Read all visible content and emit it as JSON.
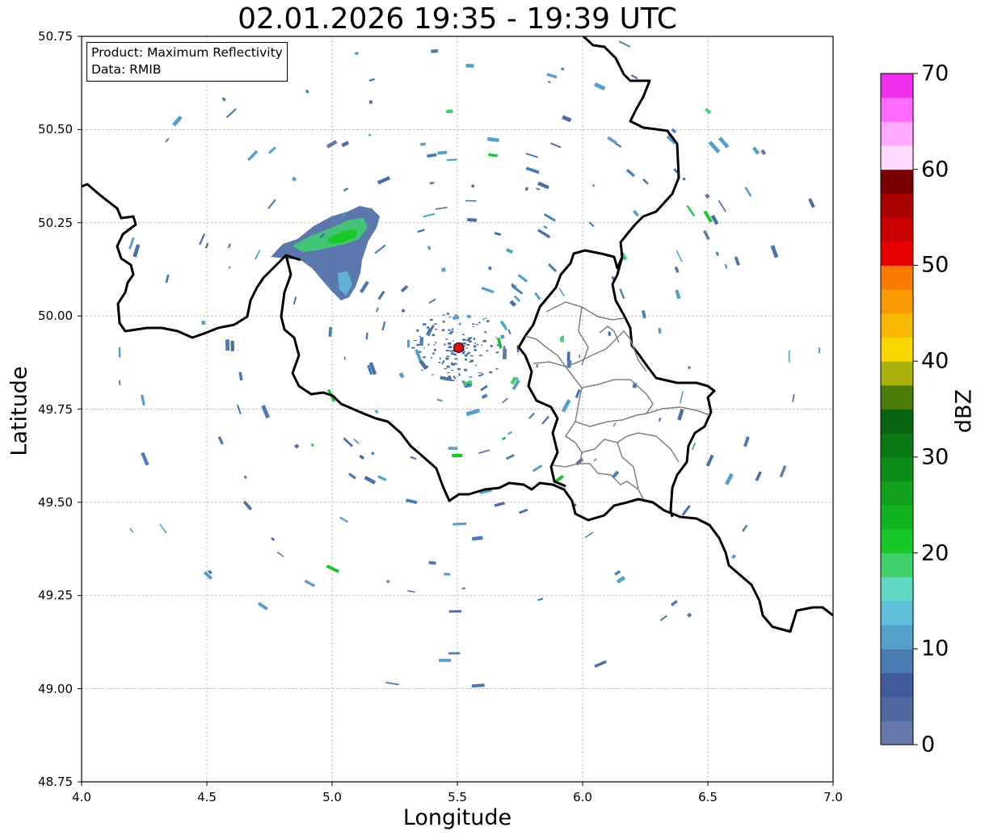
{
  "title": "02.01.2026 19:35 - 19:39 UTC",
  "info": {
    "product": "Product: Maximum Reflectivity",
    "data": "Data: RMIB"
  },
  "axes": {
    "xlabel": "Longitude",
    "ylabel": "Latitude",
    "xlim": [
      4.0,
      7.0
    ],
    "ylim": [
      48.75,
      50.75
    ],
    "xticks": [
      "4.0",
      "4.5",
      "5.0",
      "5.5",
      "6.0",
      "6.5",
      "7.0"
    ],
    "yticks": [
      "50.75",
      "50.50",
      "50.25",
      "50.00",
      "49.75",
      "49.50",
      "49.25",
      "49.00",
      "48.75"
    ],
    "grid": true
  },
  "colorbar": {
    "label": "dBZ",
    "min": 0,
    "max": 70,
    "step": 2.5,
    "ticks": [
      "0",
      "10",
      "20",
      "30",
      "40",
      "50",
      "60",
      "70"
    ],
    "colors": [
      "#6478aa",
      "#53679f",
      "#415a9c",
      "#4a7db4",
      "#55a0c8",
      "#60c0dc",
      "#60d8c4",
      "#40d06c",
      "#18c828",
      "#10b420",
      "#10a01c",
      "#0c8c18",
      "#0a7814",
      "#066410",
      "#4a7a08",
      "#aab00a",
      "#f8d800",
      "#f8b800",
      "#f89a00",
      "#f87a00",
      "#e80000",
      "#c80000",
      "#a80000",
      "#780000",
      "#ffdcff",
      "#ffaaff",
      "#ff6aff",
      "#ee30ee"
    ]
  },
  "radar_site": {
    "lon": 5.505,
    "lat": 49.915,
    "color": "#dd1111"
  },
  "map_colors": {
    "country_border": "#000000",
    "district_border": "#808080",
    "grid": "#b0b0b0"
  }
}
